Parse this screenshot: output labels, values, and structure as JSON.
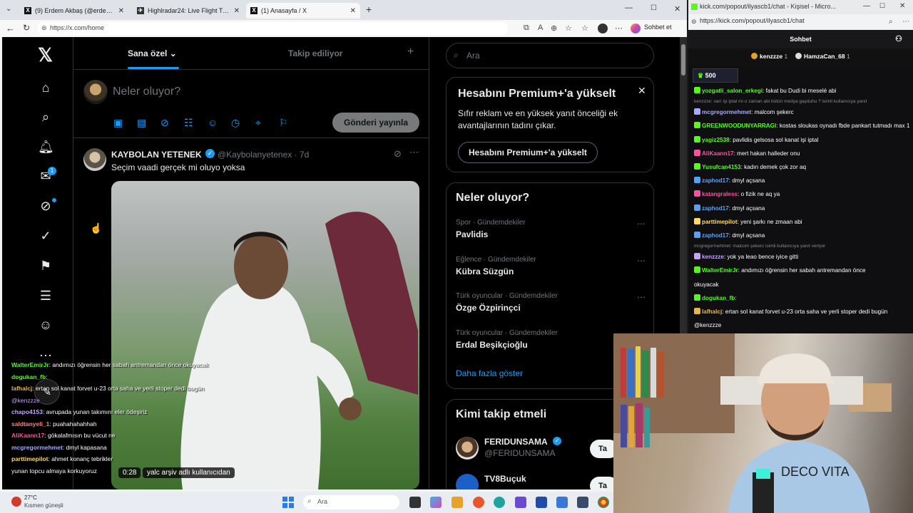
{
  "browser1": {
    "tabs": [
      {
        "label": "(9) Erdem Akbaş (@erdemakbs) / X",
        "icon": "x-logo"
      },
      {
        "label": "Highlradar24: Live Flight Tracker - Re...",
        "icon": "flightradar-icon"
      },
      {
        "label": "(1) Anasayfa / X",
        "icon": "x-logo"
      }
    ],
    "new_tab": "+",
    "url": "https://x.com/home",
    "profile_label": "Sohbet et"
  },
  "x": {
    "tabs": {
      "for_you": "Sana özel",
      "following": "Takip ediliyor"
    },
    "compose_placeholder": "Neler oluyor?",
    "post_button": "Gönderi yayınla",
    "messages_badge": "1",
    "tweet": {
      "name": "KAYBOLAN YETENEK",
      "handle": "@Kaybolanyetenex · 7d",
      "text": "Seçim vaadi gerçek mi oluyo yoksa",
      "video_time": "0:28",
      "video_credit": "yalc arşiv adlı kullanıcıdan"
    },
    "search_placeholder": "Ara",
    "premium": {
      "title": "Hesabını Premium+'a yükselt",
      "text": "Sıfır reklam ve en yüksek yanıt önceliği ek avantajlarının tadını çıkar.",
      "button": "Hesabını Premium+'a yükselt"
    },
    "trends": {
      "title": "Neler oluyor?",
      "items": [
        {
          "category": "Spor · Gündemdekiler",
          "name": "Pavlidis"
        },
        {
          "category": "Eğlence · Gündemdekiler",
          "name": "Kübra Süzgün"
        },
        {
          "category": "Türk oyuncular · Gündemdekiler",
          "name": "Özge Özpirinçci"
        },
        {
          "category": "Türk oyuncular · Gündemdekiler",
          "name": "Erdal Beşikçioğlu"
        }
      ],
      "show_more": "Daha fazla göster"
    },
    "who_to_follow": {
      "title": "Kimi takip etmeli",
      "items": [
        {
          "name": "FERIDUNSAMA",
          "handle": "@FERIDUNSAMA",
          "button": "Ta"
        },
        {
          "name": "TV8Buçuk",
          "handle": "",
          "button": "Ta"
        }
      ]
    }
  },
  "overlay_chat": [
    {
      "user": "WalterEmirJr",
      "text": ": andımızı öğrensin her sabah antremandan önce okuyacak",
      "color": "#53fc18"
    },
    {
      "user": "dogukan_fb",
      "text": ":",
      "color": "#53fc18"
    },
    {
      "user": "lafhalcj",
      "text": ": ertan sol kanat forvet u-23 orta saha ve yerli stoper dedi bugün",
      "color": "#e6b84c"
    },
    {
      "user": "",
      "text": "@kenzzze",
      "color": "#c8a0ff"
    },
    {
      "user": "chapo4153",
      "text": ": avrupada yunan takımını eler ödeşiriz",
      "color": "#c8a0ff"
    },
    {
      "user": "saldtanyeli_1",
      "text": ": puahahahahhah",
      "color": "#ff7f7f"
    },
    {
      "user": "AliKaann17",
      "text": ": gökalafmısın bu vücut ne",
      "color": "#ff4fa0"
    },
    {
      "user": "mcgregormehmet",
      "text": ": dmyl kapasana",
      "color": "#a8a8ff"
    },
    {
      "user": "parttimepilot",
      "text": ": ahmet konanç tebrikler",
      "color": "#ffd966"
    },
    {
      "user": "",
      "text": "yunan topcu almaya korkuyoruz",
      "color": "#ffffff"
    }
  ],
  "browser2": {
    "title": "kick.com/popout/ilyascb1/chat - Kişisel - Micro...",
    "url": "https://kick.com/popout/ilyascb1/chat",
    "chat_title": "Sohbet",
    "leaders": [
      {
        "name": "kenzzze",
        "count": "1"
      },
      {
        "name": "HamzaCan_68",
        "count": "1"
      }
    ],
    "sub_count": "500",
    "messages": [
      {
        "user": "yozgatli_salon_erkegi",
        "text": ": fakat bu Dudi bi meselé abi",
        "color": "#53fc18",
        "small": false
      },
      {
        "user": "",
        "text": "kenzzze: sarr işi iptal mi o zaman abi bütün medya gayduhu ? isimli kullanıcıya yanıt",
        "color": "#8a8a8a",
        "small": true
      },
      {
        "user": "mcgregormehmet",
        "text": ": malcom şekerc",
        "color": "#a8a8ff",
        "small": false
      },
      {
        "user": "GREENWOODUNYARRAGI",
        "text": ": kostas sloukas oynadı fbde pankart tutmadı max 1 hafta linçlendi",
        "color": "#53fc18",
        "small": false
      },
      {
        "user": "yagiz2538",
        "text": ": pavlidis gelsosa sol kanat işi iptal",
        "color": "#53fc18",
        "small": false
      },
      {
        "user": "AliKaann17",
        "text": ": mert hakan halleder onu",
        "color": "#ff4fa0",
        "small": false
      },
      {
        "user": "Yusufcan4153",
        "text": ": kadın demek çok zor aq",
        "color": "#53fc18",
        "small": false
      },
      {
        "user": "zaphod17",
        "text": ": dmyl açsana",
        "color": "#4fa3ff",
        "small": false
      },
      {
        "user": "katangraless",
        "text": ": o fizik ne aq ya",
        "color": "#ff4fa0",
        "small": false
      },
      {
        "user": "zaphod17",
        "text": ": dmyl açsana",
        "color": "#4fa3ff",
        "small": false
      },
      {
        "user": "parttimepilot",
        "text": ": yeni şarkı ne zmaan abi",
        "color": "#ffd966",
        "small": false
      },
      {
        "user": "zaphod17",
        "text": ": dmyl açsana",
        "color": "#4fa3ff",
        "small": false
      },
      {
        "user": "",
        "text": "mcgregormehmet: malcom şekerc isimli kullanıcıya yanıt veriyor",
        "color": "#8a8a8a",
        "small": true
      },
      {
        "user": "kenzzze",
        "text": ": yok ya leao bence iyice gitti",
        "color": "#c8a0ff",
        "small": false
      },
      {
        "user": "WalterEmirJr",
        "text": ": andımızı öğrensin her sabah antremandan önce",
        "color": "#53fc18",
        "small": false
      },
      {
        "user": "",
        "text": "okuyacak",
        "color": "#ffffff",
        "small": false
      },
      {
        "user": "dogukan_fb",
        "text": ":",
        "color": "#53fc18",
        "small": false
      },
      {
        "user": "lafhalcj",
        "text": ": ertan sol kanat forvet u-23 orta saha ve yerli stoper dedi bugün",
        "color": "#e6b84c",
        "small": false
      },
      {
        "user": "",
        "text": "@kenzzze",
        "color": "#ffffff",
        "small": false
      }
    ]
  },
  "taskbar": {
    "temp": "27°C",
    "weather": "Kısmen güneşli",
    "search": "Ara"
  }
}
